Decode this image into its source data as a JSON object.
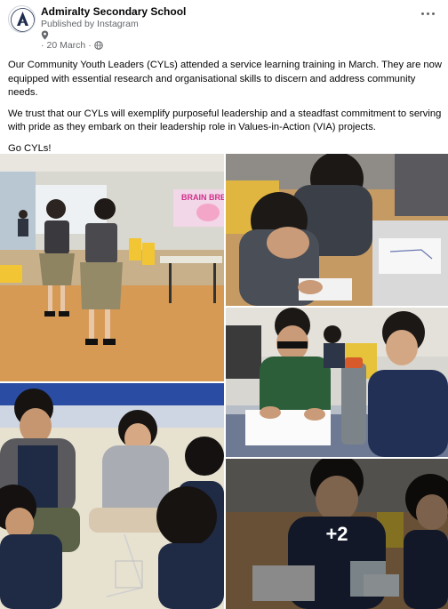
{
  "post": {
    "page_name": "Admiralty Secondary School",
    "published_by": "Published by Instagram",
    "date": "20 March",
    "privacy_icon": "globe-icon",
    "location_icon": "map-pin-icon",
    "more_icon": "more-options-icon"
  },
  "text": {
    "paragraph1": "Our Community Youth Leaders (CYLs) attended a service learning training in March. They are now equipped with essential research and organisational skills to discern and address community needs.",
    "paragraph2": "We trust that our CYLs will exemplify purposeful leadership and a steadfast commitment to serving with pride as they embark on their leadership role in Values-in-Action (VIA) projects.",
    "paragraph3": "Go CYLs!"
  },
  "gallery": {
    "photo1_sign": "BRAIN BRE",
    "more_count": "+2"
  },
  "colors": {
    "accent": "#1877f2",
    "secondary_text": "#65676b"
  }
}
